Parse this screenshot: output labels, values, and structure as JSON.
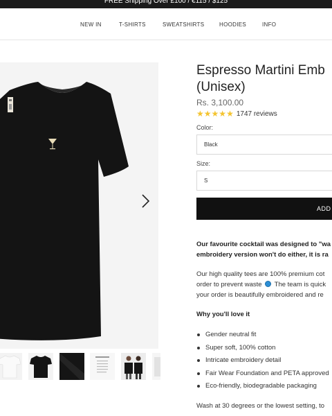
{
  "announcement": "FREE Shipping Over £100 / €115 / $125",
  "nav": {
    "items": [
      "NEW IN",
      "T-SHIRTS",
      "SWEATSHIRTS",
      "HOODIES",
      "INFO"
    ]
  },
  "gallery": {
    "next_icon": "chevron-right-icon",
    "thumbnails": [
      {
        "name": "white-tee"
      },
      {
        "name": "black-tee"
      },
      {
        "name": "fabric-closeup"
      },
      {
        "name": "size-guide-card"
      },
      {
        "name": "models-photo"
      },
      {
        "name": "partial-thumb"
      }
    ]
  },
  "product": {
    "title_line1": "Espresso Martini Emb",
    "title_line2": "(Unisex)",
    "price": "Rs. 3,100.00",
    "rating": 5,
    "reviews": "1747 reviews",
    "color_label": "Color:",
    "color_value": "Black",
    "size_label": "Size:",
    "size_value": "S",
    "add_button": "ADD"
  },
  "description": {
    "intro_line1": "Our favourite cocktail was designed to \"wa",
    "intro_line2": "embroidery version won't do either, it is ra",
    "p2_line1": "Our high quality tees are 100% premium cot",
    "p2_line2_before": "order to prevent waste",
    "p2_line2_after": "The team is quick",
    "p2_line3": "your order is beautifully embroidered and re",
    "love_heading": "Why you'll love it",
    "bullets": [
      "Gender neutral fit",
      "Super soft, 100% cotton",
      "Intricate embroidery detail",
      "Fair Wear Foundation and PETA approved",
      "Eco-friendly, biodegradable packaging"
    ],
    "care": "Wash at 30 degrees or the lowest setting, to"
  },
  "colors": {
    "star": "#f4c430",
    "button": "#111111",
    "announcement_bg": "#1b1b1b"
  }
}
